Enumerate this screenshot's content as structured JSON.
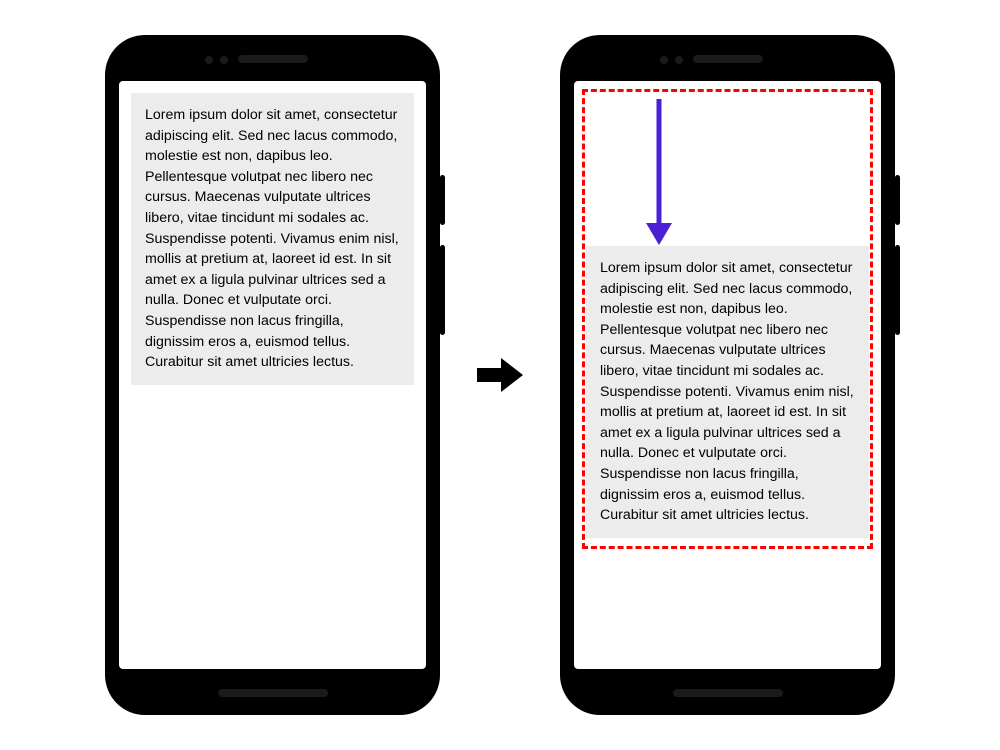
{
  "lorem_text": "Lorem ipsum dolor sit amet, consectetur adipiscing elit. Sed nec lacus commodo, molestie est non, dapibus leo. Pellentesque volutpat nec libero nec cursus. Maecenas vulputate ultrices libero, vitae tincidunt mi sodales ac. Suspendisse potenti. Vivamus enim nisl, mollis at pretium at, laoreet id est. In sit amet ex a ligula pulvinar ultrices sed a nulla. Donec et vulputate orci. Suspendisse non lacus fringilla, dignissim eros a, euismod tellus. Curabitur sit amet ultricies lectus.",
  "colors": {
    "highlight_border": "#ff0000",
    "arrow_down": "#4a1fd6",
    "arrow_transition": "#000000",
    "content_bg": "#ececec"
  }
}
